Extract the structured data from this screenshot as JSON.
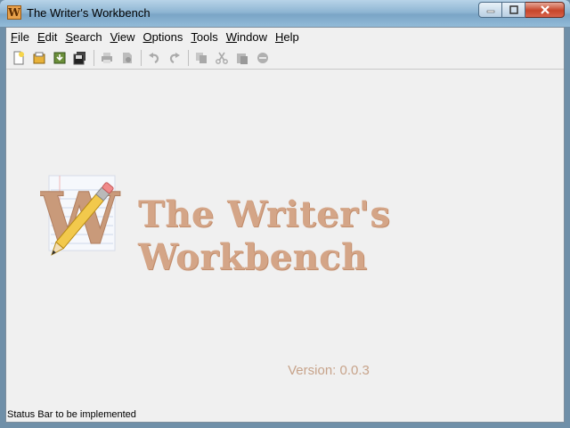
{
  "window": {
    "title": "The Writer's Workbench",
    "icon_letter": "W"
  },
  "menu": [
    {
      "key": "F",
      "rest": "ile"
    },
    {
      "key": "E",
      "rest": "dit"
    },
    {
      "key": "S",
      "rest": "earch"
    },
    {
      "key": "V",
      "rest": "iew"
    },
    {
      "key": "O",
      "rest": "ptions"
    },
    {
      "key": "T",
      "rest": "ools"
    },
    {
      "key": "W",
      "rest": "indow"
    },
    {
      "key": "H",
      "rest": "elp"
    }
  ],
  "toolbar": {
    "icons": [
      "new-document-icon",
      "open-folder-icon",
      "save-download-icon",
      "save-all-icon",
      "print-icon",
      "print-preview-icon",
      "undo-icon",
      "redo-icon",
      "copy-icon",
      "cut-icon",
      "paste-icon",
      "delete-icon"
    ]
  },
  "splash": {
    "logo_letter": "W",
    "title": "The Writer's Workbench",
    "version": "Version: 0.0.3"
  },
  "status": {
    "text": "Status Bar to be implemented"
  },
  "colors": {
    "brand": "#d4a587",
    "version": "#c7a38a",
    "logo_letter": "#c99a7a",
    "pencil": "#f2c94c"
  }
}
